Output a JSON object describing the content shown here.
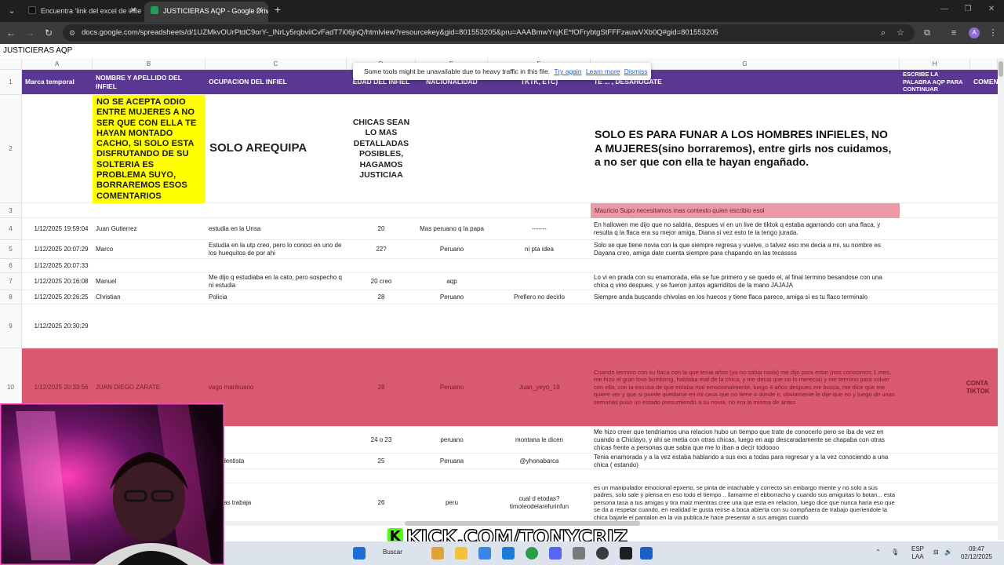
{
  "browser": {
    "tabs": [
      {
        "title": "Encuentra 'link del excel de infie...",
        "active": false
      },
      {
        "title": "JUSTICIERAS AQP - Google Drive",
        "active": true
      }
    ],
    "url": "docs.google.com/spreadsheets/d/1UZMkvOUrPtdC9orY-_lNrLy5rqbviiCvFadT7i06jnQ/htmlview?resourcekey&gid=801553205&pru=AAABmwYnjKE*fOFrybtgStFFFzauwVXb0Q#gid=801553205",
    "profile_initial": "A"
  },
  "sheet": {
    "title": "JUSTICIERAS AQP",
    "columns": [
      "A",
      "B",
      "C",
      "D",
      "E",
      "F",
      "G",
      "H"
    ],
    "header_row": {
      "a": "Marca temporal",
      "b": "NOMBRE Y APELLIDO DEL INFIEL",
      "c": "OCUPACION DEL INFIEL",
      "d": "EDAD DEL INFIEL",
      "e": "NACIONALIDAD",
      "f": "TKTK, ETC)",
      "g": "TE ... , DESAHOGATE",
      "h": "ESCRIBE LA PALABRA AQP PARA CONTINUAR",
      "i": "COMEN"
    },
    "row2": {
      "b": "NO SE ACEPTA ODIO ENTRE MUJERES A NO SER QUE CON ELLA TE HAYAN MONTADO CACHO, SI SOLO ESTA DISFRUTANDO DE SU SOLTERIA ES PROBLEMA SUYO, BORRAREMOS ESOS COMENTARIOS",
      "c": "SOLO AREQUIPA",
      "d": "CHICAS SEAN LO MAS DETALLADAS POSIBLES, HAGAMOS JUSTICIAA",
      "g": "SOLO ES PARA FUNAR A LOS HOMBRES INFIELES, NO A MUJERES(sino borraremos), entre girls nos cuidamos, a no ser que con ella te hayan engañado."
    },
    "row3": {
      "g": "Mauricio Supo necesitamos mas contexto quien escribio esol"
    },
    "rows": [
      {
        "n": "4",
        "a": "1/12/2025 19:59:04",
        "b": "Juan Gutierrez",
        "c": "estudia en la Unsa",
        "d": "20",
        "e": "Mas peruano q la papa",
        "f": "-------",
        "g": "En hallowen me dijo que no saldria, despues vi en un live de tiktok q estaba agarrando con una flaca, y resulta q la flaca era su mejor amiga, Diana si vez esto te la tengo jurada."
      },
      {
        "n": "5",
        "a": "1/12/2025 20:07:29",
        "b": "Marco",
        "c": "Estudia en la utp creo, pero lo conoci en uno de los huequitos de por ahi",
        "d": "22?",
        "e": "Peruano",
        "f": "ni pta idea",
        "g": "Solo se que tiene novia con la que siempre regresa y vuelve, o talvez eso me decia a mi, su nombre es Dayana creo, amiga date cuenta siempre para chapando en las tecassss"
      },
      {
        "n": "6",
        "a": "1/12/2025 20:07:33",
        "b": "",
        "c": "",
        "d": "",
        "e": "",
        "f": "",
        "g": ""
      },
      {
        "n": "7",
        "a": "1/12/2025 20:16:08",
        "b": "Manuel",
        "c": "Me dijo q estudiaba en la cato, pero sospecho q ni estudia",
        "d": "20 creo",
        "e": "aqp",
        "f": "",
        "g": "Lo vi en prada con su enamorada, ella se fue primero y se quedo el, al final termino besandose con una chica q vino despues, y se fueron juntos agarriditos de la mano JAJAJA"
      },
      {
        "n": "8",
        "a": "1/12/2025 20:26:25",
        "b": "Christian",
        "c": "Policia",
        "d": "28",
        "e": "Peruano",
        "f": "Prefiero no decirlo",
        "g": "Siempre anda buscando chivolas en los huecos y tiene flaca parece, amiga si es tu flaco terminalo"
      },
      {
        "n": "9",
        "a": "1/12/2025 20:30:29",
        "b": "",
        "c": "",
        "d": "",
        "e": "",
        "f": "",
        "g": ""
      },
      {
        "n": "10",
        "a": "1/12/2025 20:33:56",
        "b": "JUAN DIEGO ZARATE",
        "c": "vago marihuano",
        "d": "28",
        "e": "Peruano",
        "f": "Juan_yeyo_19",
        "g": "Cuando termino con su flaca con la que tenia años (yo no sabia nada) me dijo para estar (nos conocimos 1 mes, me hizo el gran love bombimg, hablaba mal de la chica, y me decia que no lo merecia) y me termino para volver con ella, con la excusa de que estaba mal emocionalmente, luego 4 años despues me busca, me dice que me quiere ver y que si puede quedarse en mi casa que no tiene a donde ir, obviamente le dije que no y luego de unas semanas puso un estado presumiendo a su novia, no era la misma de antes",
        "i": "CONTA TIKTOK"
      },
      {
        "n": "",
        "a": "",
        "b": "",
        "c": "...litar",
        "d": "24 o 23",
        "e": "peruano",
        "f": "montana le dicen",
        "g": "Me hizo creer que tendriamos una relacion hubo un tiempo que trate de conocerlo pero se iba de vez en cuando a Chiclayo, y ahi se metia con otras chicas, luego en aqp descaradamente se chapaba con otras chicas frente a personas que sabia que me lo iban a decir todoooo"
      },
      {
        "n": "",
        "a": "",
        "b": "",
        "c": "...co dentista",
        "d": "25",
        "e": "Peruana",
        "f": "@yhonabarca",
        "g": "Tenia enamorada y a la vez estaba hablando a sus exs a todas para regresar y a la vez conociendo a una chica ( estando)"
      },
      {
        "n": "",
        "a": "",
        "b": "",
        "c": "",
        "d": "",
        "e": "",
        "f": "",
        "g": ""
      },
      {
        "n": "",
        "a": "",
        "b": "",
        "c": "...justas trabaja",
        "d": "26",
        "e": "peru",
        "f": "cual d etodas? timoteodelarefurinfun",
        "g": "es un manipulador emocional epxerto, se pinta de intachable y correcto sin embargo miente y no solo a sus padres, solo sale y piensa en eso todo el tiempo .. llamarme el ebborracho y cuando sus amiguitas lo botan... esta persona tasa a tus amigas y tira maiz mientras cree una que esta en relacion, luego dice que nunca haria eso que se da a respetar cuando, en realidad le gusta reirse a boca abierta con su compñaera de trabajo queriendole la chica bajarle el pantalon en la via publica,te hace presentar a sus amigas cuando"
      }
    ]
  },
  "toast": {
    "message": "Some tools might be unavailable due to heavy traffic in this file.",
    "try_again": "Try again",
    "learn_more": "Learn more",
    "dismiss": "Dismiss"
  },
  "overlay": {
    "kick_logo": "K",
    "kick_text": "KICK.COM/TONYCRIZ"
  },
  "taskbar": {
    "search": "Buscar",
    "lang_top": "ESP",
    "lang_bottom": "LAA",
    "time": "09:47",
    "date": "02/12/2025"
  },
  "colors": {
    "header_purple": "#5b3794",
    "red_row": "#d9596e",
    "yellow": "#ffff00",
    "kick_green": "#53fc18"
  }
}
